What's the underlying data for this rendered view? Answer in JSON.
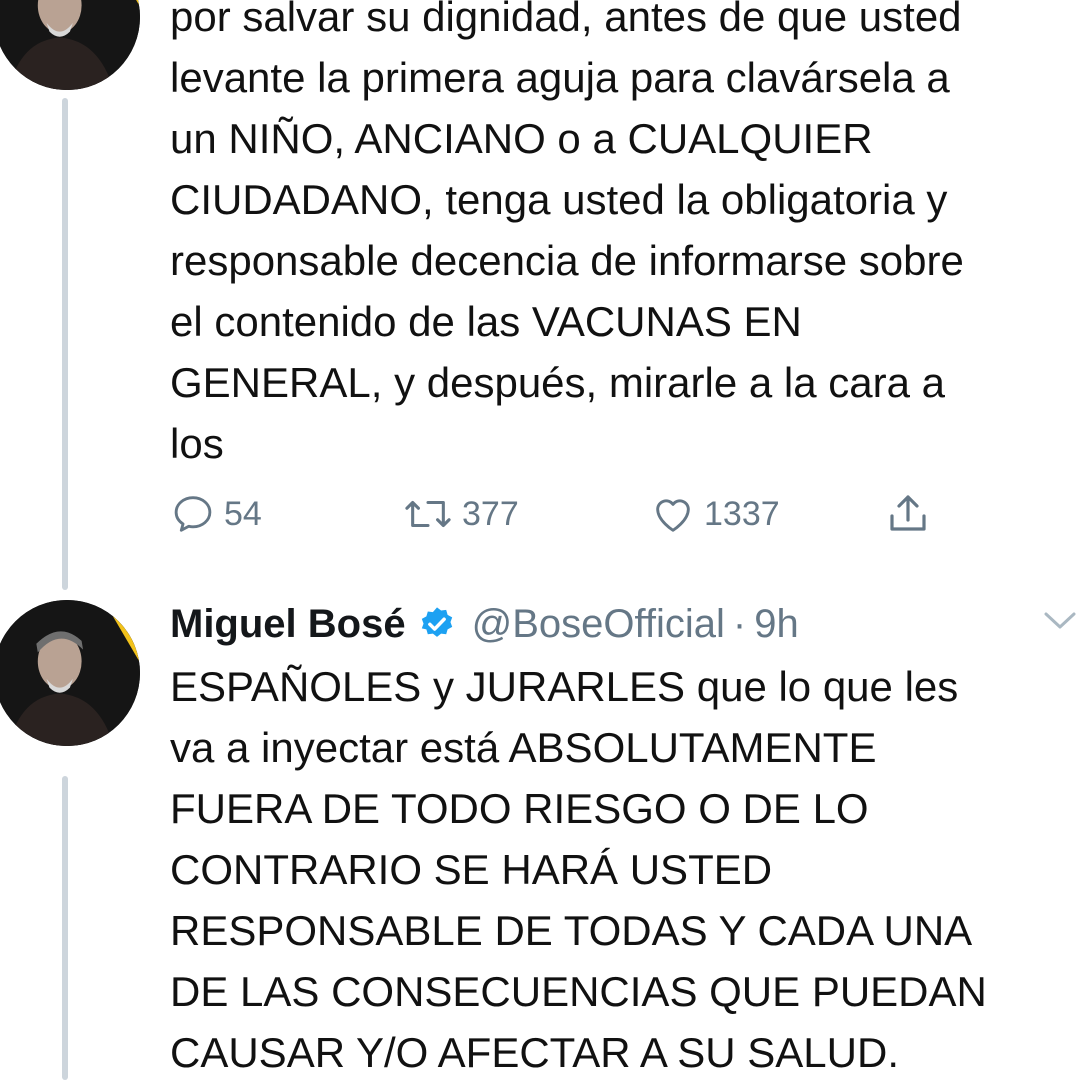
{
  "tweet_1": {
    "text": "por salvar su dignidad, antes de que usted\nlevante la primera aguja para clavársela a\nun NIÑO, ANCIANO o a CUALQUIER\nCIUDADANO, tenga usted la obligatoria y\nresponsable decencia de informarse sobre\nel contenido de las VACUNAS EN\nGENERAL, y después, mirarle a la cara a\nlos",
    "actions": {
      "reply_icon": "reply-icon",
      "reply_count": "54",
      "retweet_icon": "retweet-icon",
      "retweet_count": "377",
      "like_icon": "like-icon",
      "like_count": "1337",
      "share_icon": "share-icon"
    }
  },
  "tweet_2": {
    "author": {
      "name": "Miguel Bosé",
      "handle": "@BoseOfficial",
      "verified_icon": "verified-badge-icon",
      "separator": "·",
      "time": "9h"
    },
    "menu_icon": "chevron-down-icon",
    "text": "ESPAÑOLES y JURARLES que lo que les\nva a inyectar está ABSOLUTAMENTE\nFUERA DE TODO RIESGO O DE LO\nCONTRARIO SE HARÁ USTED\nRESPONSABLE DE TODAS Y CADA UNA\nDE LAS CONSECUENCIAS QUE PUEDAN\nCAUSAR Y/O AFECTAR A SU SALUD."
  },
  "colors": {
    "text": "#14171a",
    "secondary": "#657786",
    "verified": "#1da1f2",
    "thread_line": "#cdd5dc",
    "avatar_ring": "#f2c21b"
  }
}
